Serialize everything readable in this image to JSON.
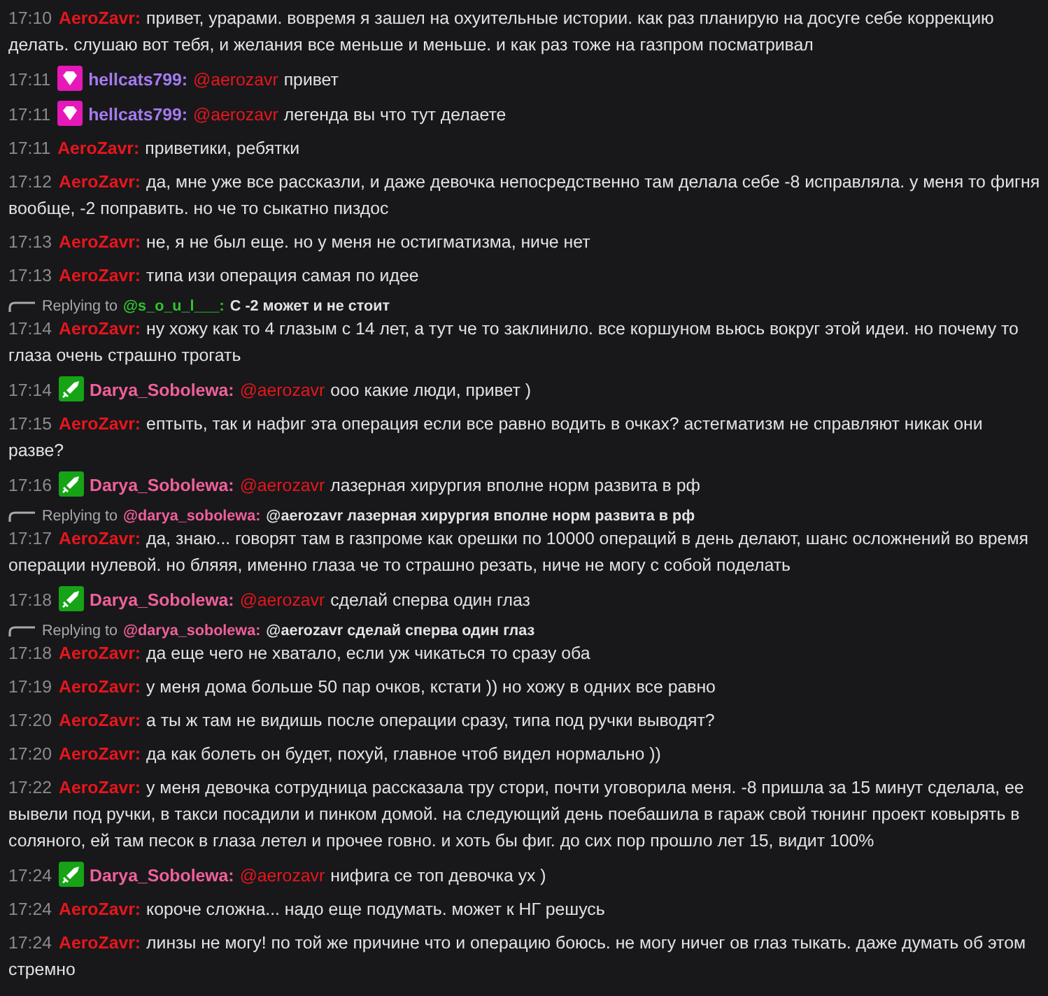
{
  "messages": [
    {
      "time": "17:10",
      "user": {
        "name": "AeroZavr:",
        "color": "#e8161b"
      },
      "text": "привет, урарами. вовремя я зашел на охуительные истории. как раз планирую на досуге себе коррекцию делать. слушаю вот тебя, и желания все меньше и меньше. и как раз тоже на газпром посматривал"
    },
    {
      "time": "17:11",
      "badge": {
        "kind": "gem"
      },
      "user": {
        "name": "hellcats799:",
        "color": "#a57bf0"
      },
      "mention": {
        "text": "@aerozavr",
        "color": "#e8161b"
      },
      "text": "привет"
    },
    {
      "time": "17:11",
      "badge": {
        "kind": "gem"
      },
      "user": {
        "name": "hellcats799:",
        "color": "#a57bf0"
      },
      "mention": {
        "text": "@aerozavr",
        "color": "#e8161b"
      },
      "text": "легенда вы что тут делаете"
    },
    {
      "time": "17:11",
      "user": {
        "name": "AeroZavr:",
        "color": "#e8161b"
      },
      "text": "приветики, ребятки"
    },
    {
      "time": "17:12",
      "user": {
        "name": "AeroZavr:",
        "color": "#e8161b"
      },
      "text": "да, мне уже все рассказли, и даже девочка непосредственно там делала себе -8 исправляла. у меня то фигня вообще, -2 поправить. но че то сыкатно пиздос"
    },
    {
      "time": "17:13",
      "user": {
        "name": "AeroZavr:",
        "color": "#e8161b"
      },
      "text": "не, я не был еще. но у меня не остигматизма, ниче нет"
    },
    {
      "time": "17:13",
      "user": {
        "name": "AeroZavr:",
        "color": "#e8161b"
      },
      "text": "типа изи операция самая по идее"
    },
    {
      "reply": {
        "label": "Replying to",
        "to": {
          "text": "@s_o_u_l___:",
          "color": "#2fc52b"
        },
        "text": "С -2 может и не стоит"
      },
      "time": "17:14",
      "user": {
        "name": "AeroZavr:",
        "color": "#e8161b"
      },
      "text": "ну хожу как то 4 глазым с 14 лет, а тут че то заклинило. все коршуном вьюсь вокруг этой идеи. но почему то глаза очень страшно трогать"
    },
    {
      "time": "17:14",
      "badge": {
        "kind": "sword"
      },
      "user": {
        "name": "Darya_Sobolewa:",
        "color": "#f0609a"
      },
      "mention": {
        "text": "@aerozavr",
        "color": "#e8161b"
      },
      "text": "ооо какие люди, привет )"
    },
    {
      "time": "17:15",
      "user": {
        "name": "AeroZavr:",
        "color": "#e8161b"
      },
      "text": "ептыть, так и нафиг эта операция если все равно водить в очках? астегматизм не справляют никак они разве?"
    },
    {
      "time": "17:16",
      "badge": {
        "kind": "sword"
      },
      "user": {
        "name": "Darya_Sobolewa:",
        "color": "#f0609a"
      },
      "mention": {
        "text": "@aerozavr",
        "color": "#e8161b"
      },
      "text": "лазерная хирургия вполне норм развита в рф"
    },
    {
      "reply": {
        "label": "Replying to",
        "to": {
          "text": "@darya_sobolewa:",
          "color": "#f0609a"
        },
        "text": "@aerozavr лазерная хирургия вполне норм развита в рф"
      },
      "time": "17:17",
      "user": {
        "name": "AeroZavr:",
        "color": "#e8161b"
      },
      "text": "да, знаю... говорят там в газпроме как орешки по 10000 операций в день делают, шанс осложнений во время операции нулевой. но бляяя, именно глаза че то страшно резать, ниче не могу с собой поделать"
    },
    {
      "time": "17:18",
      "badge": {
        "kind": "sword"
      },
      "user": {
        "name": "Darya_Sobolewa:",
        "color": "#f0609a"
      },
      "mention": {
        "text": "@aerozavr",
        "color": "#e8161b"
      },
      "text": "сделай сперва один глаз"
    },
    {
      "reply": {
        "label": "Replying to",
        "to": {
          "text": "@darya_sobolewa:",
          "color": "#f0609a"
        },
        "text": "@aerozavr сделай сперва один глаз"
      },
      "time": "17:18",
      "user": {
        "name": "AeroZavr:",
        "color": "#e8161b"
      },
      "text": "да еще чего не хватало, если уж чикаться то сразу оба"
    },
    {
      "time": "17:19",
      "user": {
        "name": "AeroZavr:",
        "color": "#e8161b"
      },
      "text": "у меня дома больше 50 пар очков, кстати )) но хожу в одних все равно"
    },
    {
      "time": "17:20",
      "user": {
        "name": "AeroZavr:",
        "color": "#e8161b"
      },
      "text": "а ты ж там не видишь после операции сразу, типа под ручки выводят?"
    },
    {
      "time": "17:20",
      "user": {
        "name": "AeroZavr:",
        "color": "#e8161b"
      },
      "text": "да как болеть он будет, похуй, главное чтоб видел нормально ))"
    },
    {
      "time": "17:22",
      "user": {
        "name": "AeroZavr:",
        "color": "#e8161b"
      },
      "text": "у меня девочка сотрудница рассказала тру стори, почти уговорила меня. -8 пришла за 15 минут сделала, ее вывели под ручки, в такси посадили и пинком домой. на следующий день поебашила в гараж свой тюнинг проект ковырять в соляного, ей там песок в глаза летел и прочее говно. и хоть бы фиг. до сих пор прошло лет 15, видит 100%"
    },
    {
      "time": "17:24",
      "badge": {
        "kind": "sword"
      },
      "user": {
        "name": "Darya_Sobolewa:",
        "color": "#f0609a"
      },
      "mention": {
        "text": "@aerozavr",
        "color": "#e8161b"
      },
      "text": "нифига се топ девочка ух )"
    },
    {
      "time": "17:24",
      "user": {
        "name": "AeroZavr:",
        "color": "#e8161b"
      },
      "text": "короче сложна... надо еще подумать. может к НГ решусь"
    },
    {
      "time": "17:24",
      "user": {
        "name": "AeroZavr:",
        "color": "#e8161b"
      },
      "text": "линзы не могу! по той же причине что и операцию боюсь. не могу ничег ов глаз тыкать. даже думать об этом стремно"
    }
  ]
}
